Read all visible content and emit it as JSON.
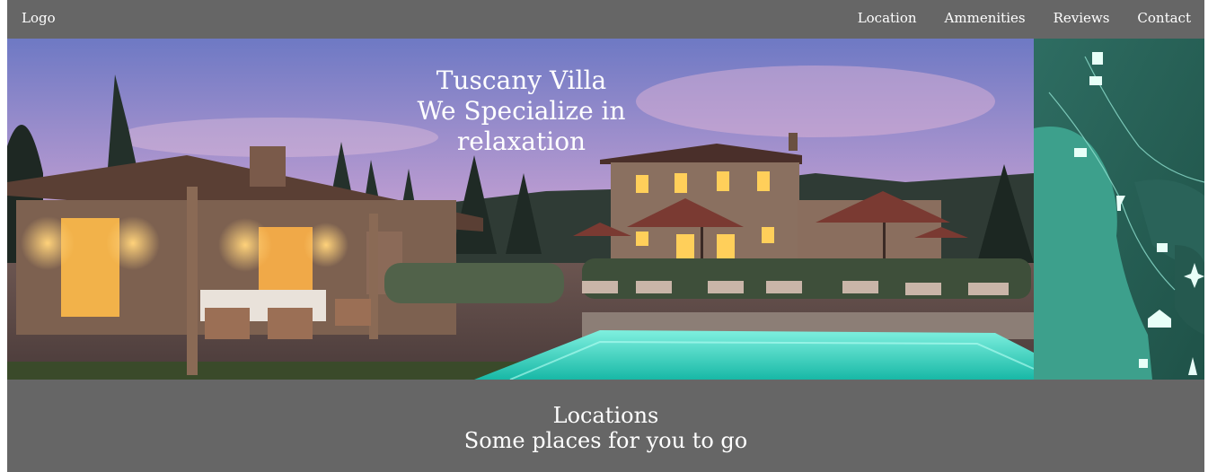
{
  "navbar": {
    "logo": "Logo",
    "links": [
      "Location",
      "Ammenities",
      "Reviews",
      "Contact"
    ]
  },
  "hero": {
    "title": "Tuscany Villa",
    "subtitle": "We Specialize in relaxation"
  },
  "locations": {
    "title": "Locations",
    "subtitle": "Some places for you to go"
  },
  "colors": {
    "nav_bg": "#666666",
    "text": "#ffffff",
    "pool": "#3fe0c8",
    "map": "#2f7a6c"
  }
}
